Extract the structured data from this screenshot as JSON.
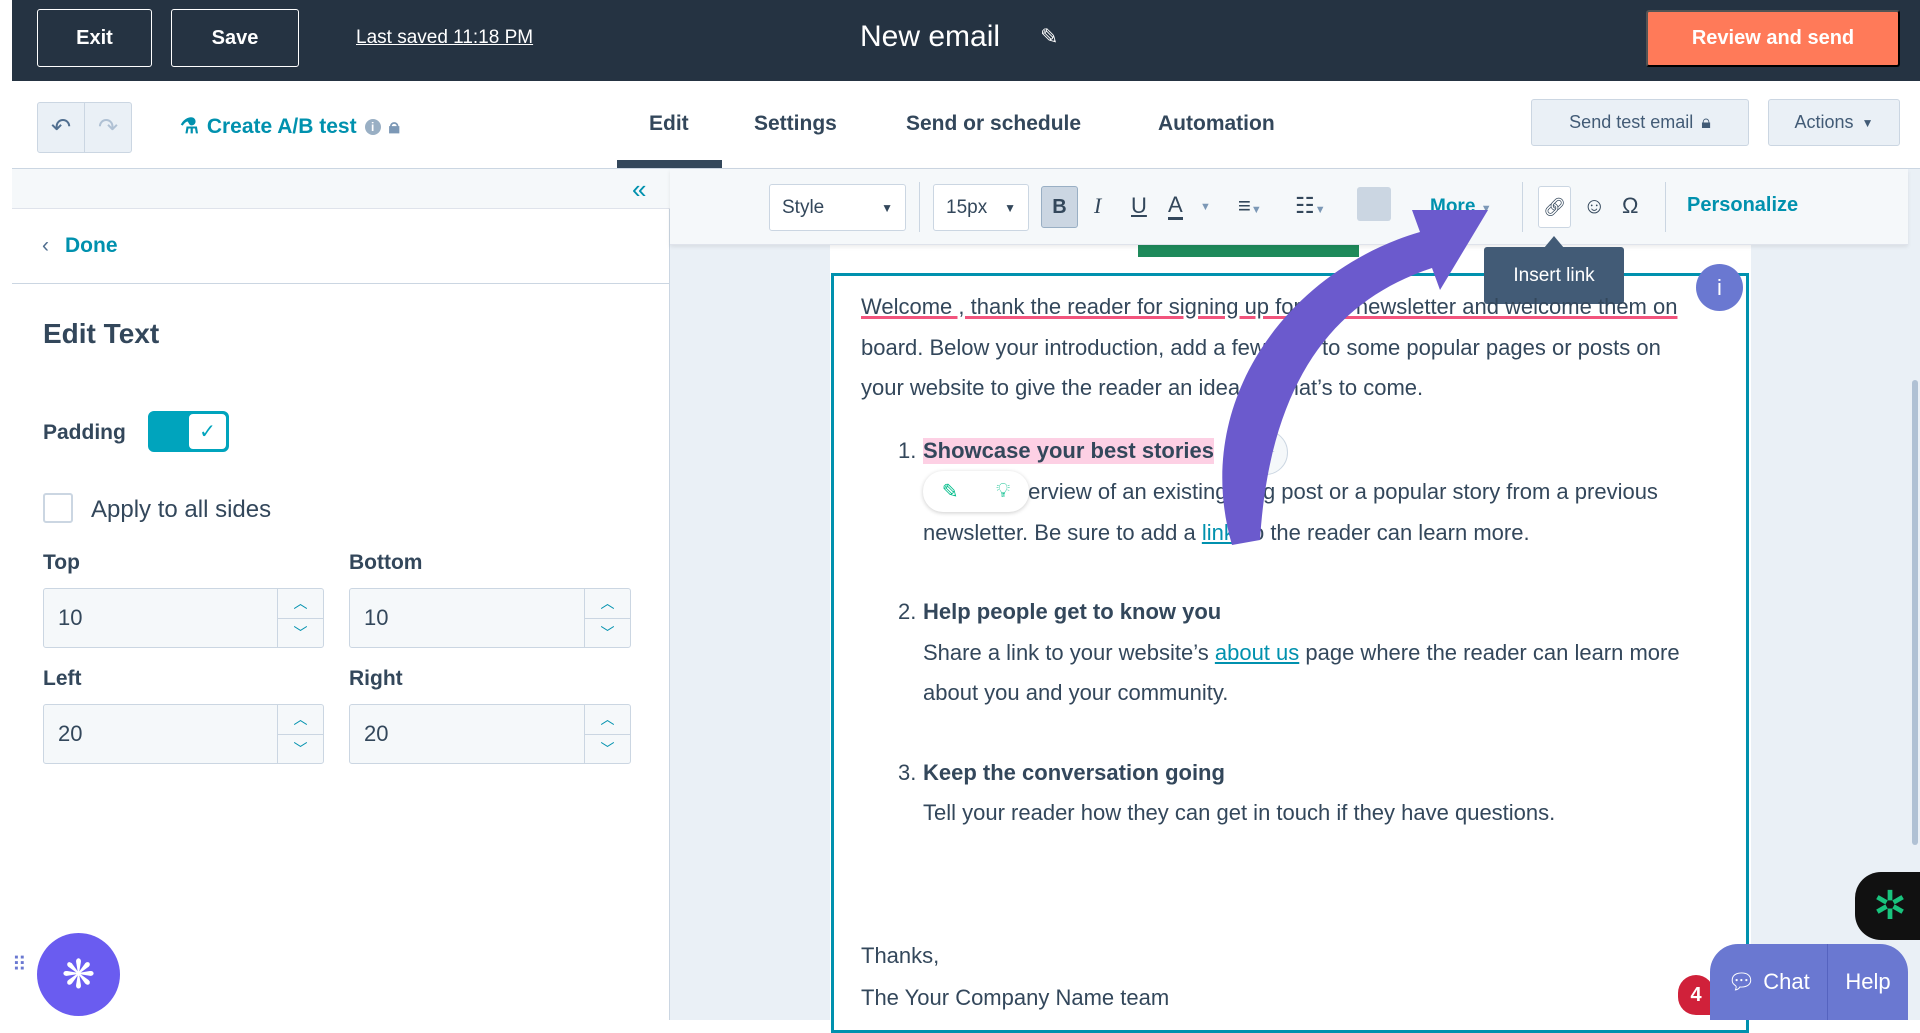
{
  "header": {
    "exit_label": "Exit",
    "save_label": "Save",
    "last_saved": "Last saved 11:18 PM",
    "title": "New email",
    "review_label": "Review and send"
  },
  "subnav": {
    "ab_test": "Create A/B test",
    "tabs": [
      {
        "label": "Edit",
        "active": true
      },
      {
        "label": "Settings"
      },
      {
        "label": "Send or schedule"
      },
      {
        "label": "Automation"
      }
    ],
    "send_test": "Send test email",
    "actions": "Actions"
  },
  "sidebar": {
    "done": "Done",
    "heading": "Edit Text",
    "padding_label": "Padding",
    "padding_on": true,
    "apply_all": "Apply to all sides",
    "apply_all_checked": false,
    "fields": [
      {
        "label": "Top",
        "value": "10"
      },
      {
        "label": "Bottom",
        "value": "10"
      },
      {
        "label": "Left",
        "value": "20"
      },
      {
        "label": "Right",
        "value": "20"
      }
    ]
  },
  "toolbar": {
    "style": "Style",
    "size": "15px",
    "bold": "B",
    "italic": "I",
    "underline": "U",
    "color": "A",
    "more": "More",
    "personalize": "Personalize",
    "tooltip": "Insert link"
  },
  "email": {
    "intro": [
      "Welcome , thank the reader for signing up for your newsletter and welcome them on",
      "board. Below your introduction, add a few links to some popular pages or posts on",
      "your website to give the reader an idea of what’s to come."
    ],
    "items": [
      {
        "n": "1.",
        "title": "Showcase your best stories",
        "lines": [
          "Give an overview of an existing blog post or a popular story from a previous",
          "newsletter. Be sure to add a ",
          "link",
          " so the reader can learn more."
        ]
      },
      {
        "n": "2.",
        "title": "Help people get to know you",
        "lines": [
          "Share a link to your website’s ",
          "about us",
          " page where the reader can learn more",
          "about you and your community."
        ]
      },
      {
        "n": "3.",
        "title": "Keep the conversation going",
        "lines": [
          "Tell your reader how they can get in touch if they have questions."
        ]
      }
    ],
    "thanks": "Thanks,",
    "signature": "The Your Company Name team"
  },
  "widgets": {
    "info": "i",
    "chat": "Chat",
    "help": "Help",
    "badge": "4"
  },
  "colors": {
    "nav": "#253342",
    "accent": "#ff7a59",
    "teal": "#0091ae",
    "arrow": "#6b5acd",
    "chat": "#6a78d1"
  }
}
